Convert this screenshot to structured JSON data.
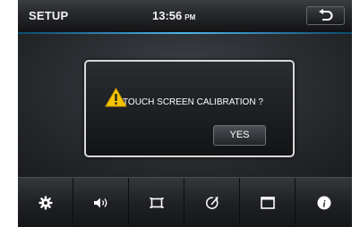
{
  "header": {
    "title": "SETUP",
    "time": "13:56",
    "ampm": "PM"
  },
  "dialog": {
    "message": "TOUCH SCREEN CALIBRATION ?",
    "yes_label": "YES"
  },
  "bottom_tabs": [
    {
      "icon": "gear-icon"
    },
    {
      "icon": "speaker-icon"
    },
    {
      "icon": "display-icon"
    },
    {
      "icon": "calibration-icon"
    },
    {
      "icon": "screen-icon"
    },
    {
      "icon": "info-icon"
    }
  ],
  "colors": {
    "accent_line": "#4fb6ea",
    "warning": "#f5c400"
  }
}
